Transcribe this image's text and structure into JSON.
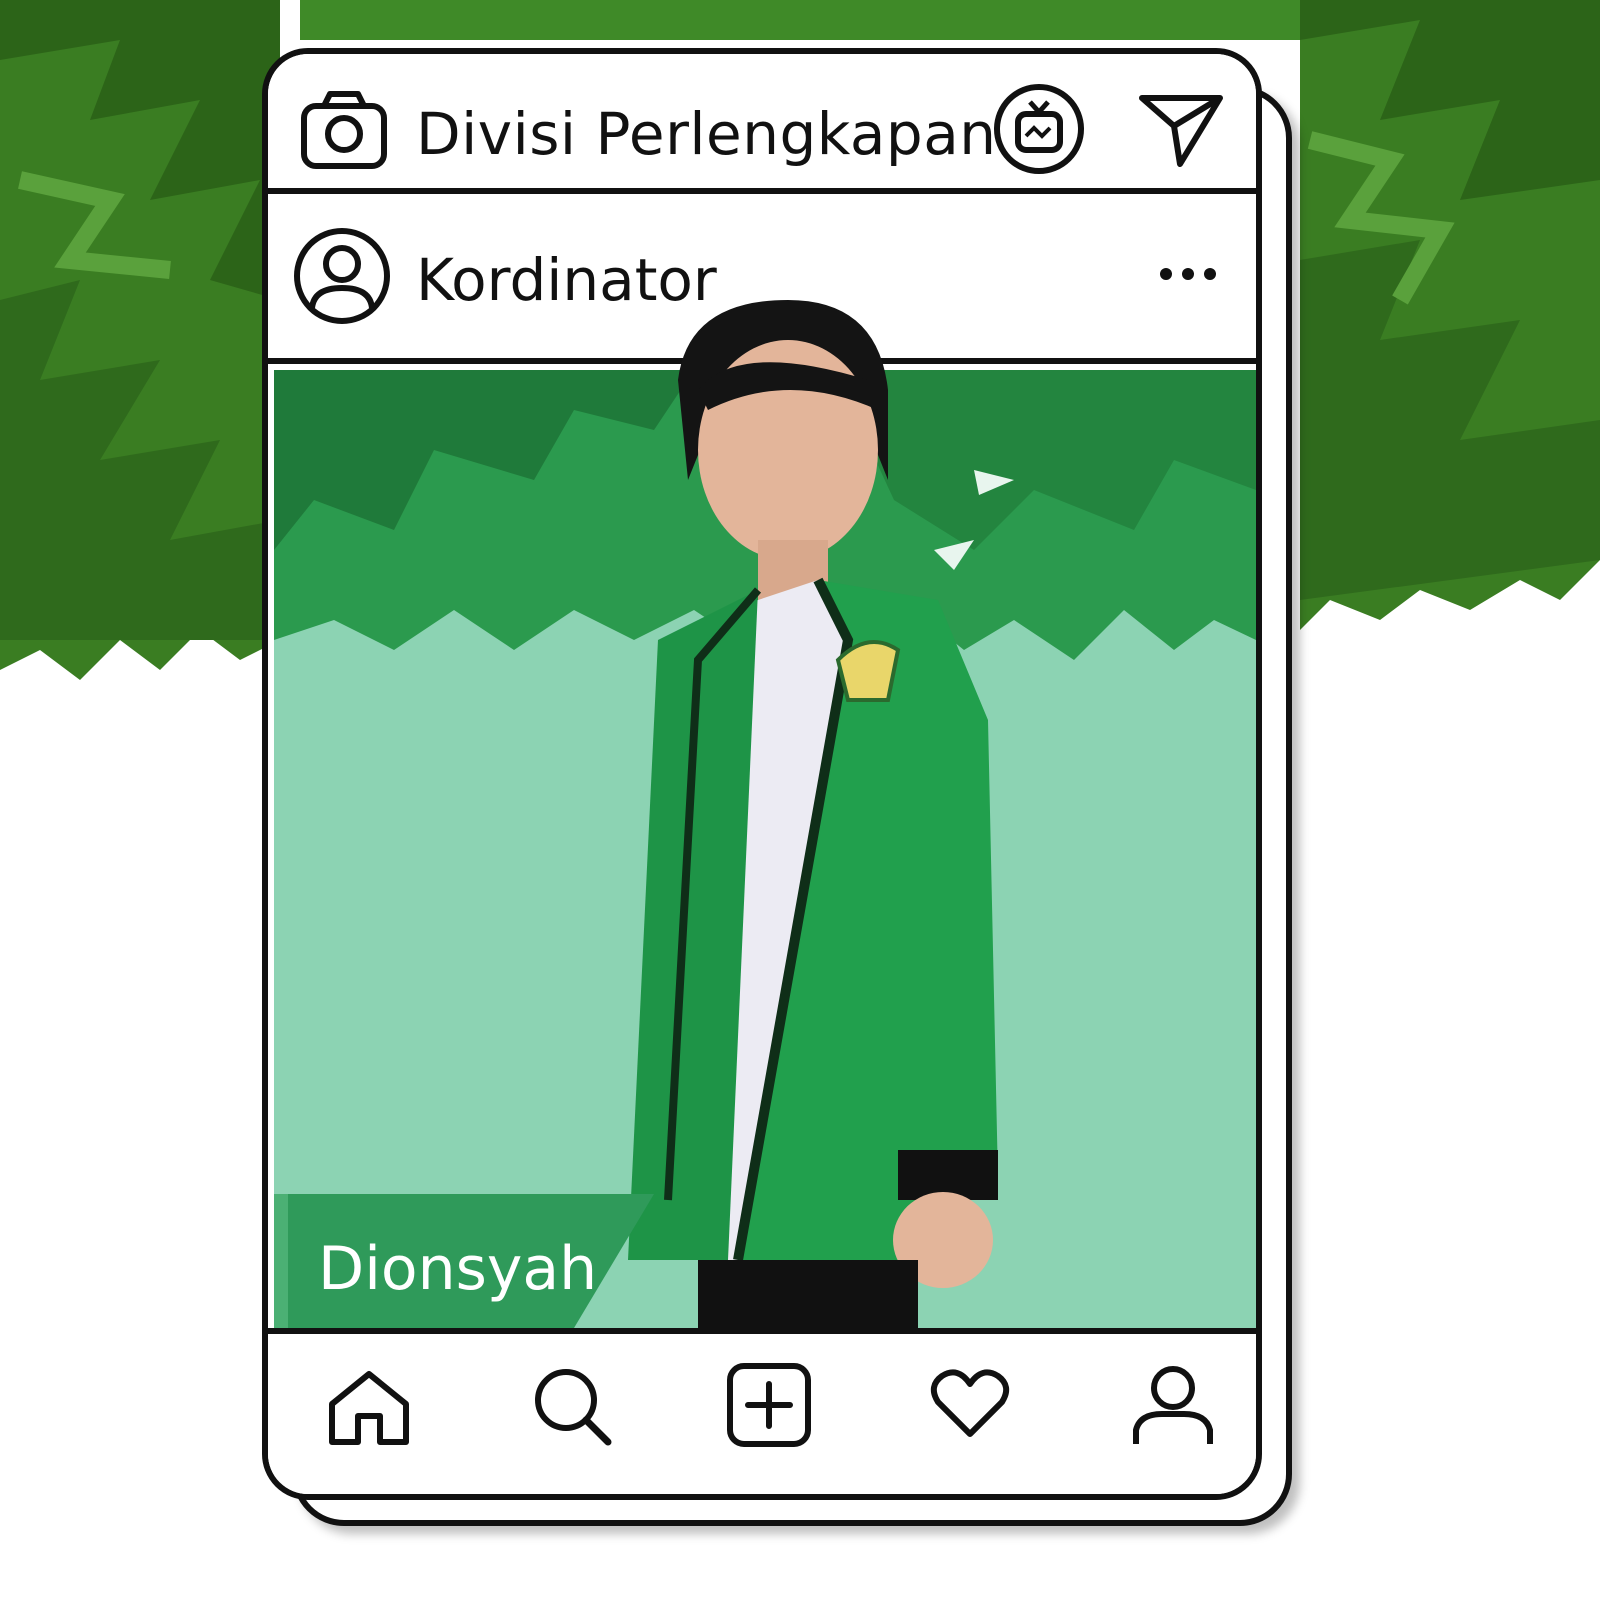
{
  "header": {
    "title": "Divisi Perlengkapan",
    "camera_icon": "camera-icon",
    "igtv_icon": "igtv-icon",
    "send_icon": "send-icon"
  },
  "post": {
    "username": "Kordinator",
    "avatar_icon": "user-avatar-icon",
    "more_icon": "more-options-icon",
    "caption_name": "Dionsyah"
  },
  "navbar": {
    "items": [
      {
        "icon": "home-icon"
      },
      {
        "icon": "search-icon"
      },
      {
        "icon": "add-post-icon"
      },
      {
        "icon": "heart-icon"
      },
      {
        "icon": "profile-icon"
      }
    ]
  },
  "colors": {
    "foliage_dark": "#2f6a1c",
    "foliage_mid": "#3f8a28",
    "photo_bg": "#8cd3b3",
    "photo_trees": "#2b9a4e",
    "name_tag": "#2f9a5a",
    "jacket": "#1f9a4a"
  }
}
